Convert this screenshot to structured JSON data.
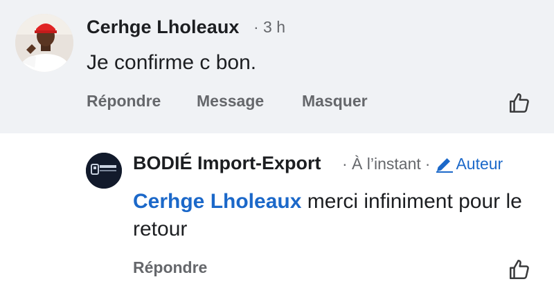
{
  "comment": {
    "author": "Cerhge Lholeaux",
    "meta": "· 3 h",
    "text": "Je confirme c bon.",
    "actions": {
      "reply": "Répondre",
      "message": "Message",
      "hide": "Masquer"
    }
  },
  "reply": {
    "author": "BODIÉ Import-Export",
    "time": "· À l’instant",
    "sep": "·",
    "badge": "Auteur",
    "mention": "Cerhge Lholeaux",
    "text": " merci infiniment pour le retour",
    "actions": {
      "reply": "Répondre"
    }
  },
  "colors": {
    "link": "#1b68c9",
    "muted": "#65676b",
    "background_top": "#f0f2f5"
  },
  "icons": [
    "thumbs-up-icon",
    "pencil-icon"
  ]
}
